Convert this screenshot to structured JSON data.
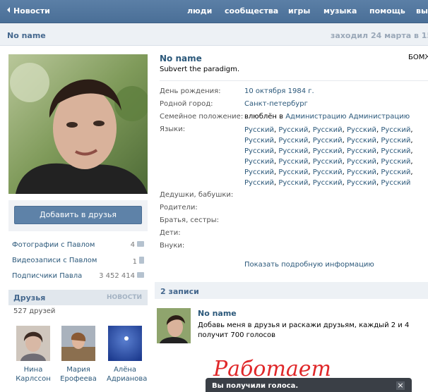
{
  "topbar": {
    "back_label": "Новости",
    "nav": [
      "люди",
      "сообщества",
      "игры",
      "музыка",
      "помощь",
      "вы"
    ]
  },
  "page_header": {
    "name": "No name",
    "last_seen": "заходил 24 марта в 15:2"
  },
  "left": {
    "add_friend_label": "Добавить в друзья",
    "links": [
      {
        "label": "Фотографии с Павлом",
        "count": "4"
      },
      {
        "label": "Видеозаписи с Павлом",
        "count": "1"
      },
      {
        "label": "Подписчики Павла",
        "count": "3 452 414"
      }
    ],
    "friends_title": "Друзья",
    "friends_news": "НОВОСТИ",
    "friends_count": "527 друзей",
    "friends": [
      {
        "first": "Нина",
        "last": "Карлссон"
      },
      {
        "first": "Мария",
        "last": "Ерофеева"
      },
      {
        "first": "Алёна",
        "last": "Адрианова"
      }
    ]
  },
  "profile": {
    "name": "No name",
    "status": "Subvert the paradigm.",
    "tag": "БОМЖ",
    "birthday_label": "День рождения:",
    "birthday_value": "10 октября 1984 г.",
    "hometown_label": "Родной город:",
    "hometown_value": "Санкт-петербург",
    "family_label": "Семейное положение:",
    "family_prefix": "влюблён в",
    "family_value": "Администрацию Администрацию",
    "languages_label": "Языки:",
    "languages": [
      "Русский",
      "Русский",
      "Русский",
      "Русский",
      "Русский",
      "Русский",
      "Русский",
      "Русский",
      "Русский",
      "Русский",
      "Русский",
      "Русский",
      "Русский",
      "Русский",
      "Русский",
      "Русский",
      "Русский",
      "Русский",
      "Русский",
      "Русский",
      "Русский",
      "Русский",
      "Русский",
      "Русский",
      "Русский",
      "Русский",
      "Русский",
      "Русский",
      "Русский",
      "Русский"
    ],
    "grandparents_label": "Дедушки, бабушки:",
    "parents_label": "Родители:",
    "siblings_label": "Братья, сестры:",
    "children_label": "Дети:",
    "grandchildren_label": "Внуки:",
    "show_more": "Показать подробную информацию"
  },
  "wall": {
    "title": "2 записи",
    "post": {
      "author": "No name",
      "text": "Добавь меня в друзья и раскажи друзьям, каждый 2 и 4 получит 700 голосов"
    },
    "scribble_text": "Работает"
  },
  "toast": {
    "text": "Вы получили голоса.",
    "close": "×"
  },
  "colors": {
    "topbar": "#4a6f97",
    "link": "#2b587a",
    "header_bg": "#edf1f5",
    "scribble": "#e0282a"
  }
}
